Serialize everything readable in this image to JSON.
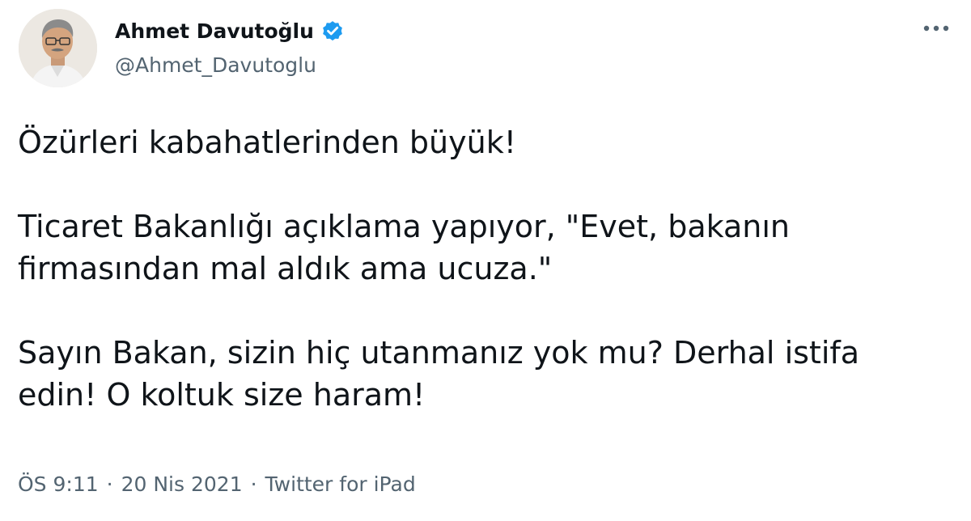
{
  "author": {
    "display_name": "Ahmet Davutoğlu",
    "handle": "@Ahmet_Davutoglu",
    "verified": true,
    "verified_color": "#1d9bf0"
  },
  "more_icon": "more-horizontal-icon",
  "tweet": {
    "lines": [
      "Özürleri kabahatlerinden büyük!",
      "Ticaret Bakanlığı açıklama yapıyor, \"Evet, bakanın",
      "firmasından mal aldık ama ucuza.\"",
      "Sayın Bakan, sizin hiç utanmanız yok mu? Derhal istifa",
      "edin! O koltuk size haram!"
    ]
  },
  "meta": {
    "time": "ÖS 9:11",
    "separator": "·",
    "date": "20 Nis 2021",
    "source": "Twitter for iPad"
  }
}
